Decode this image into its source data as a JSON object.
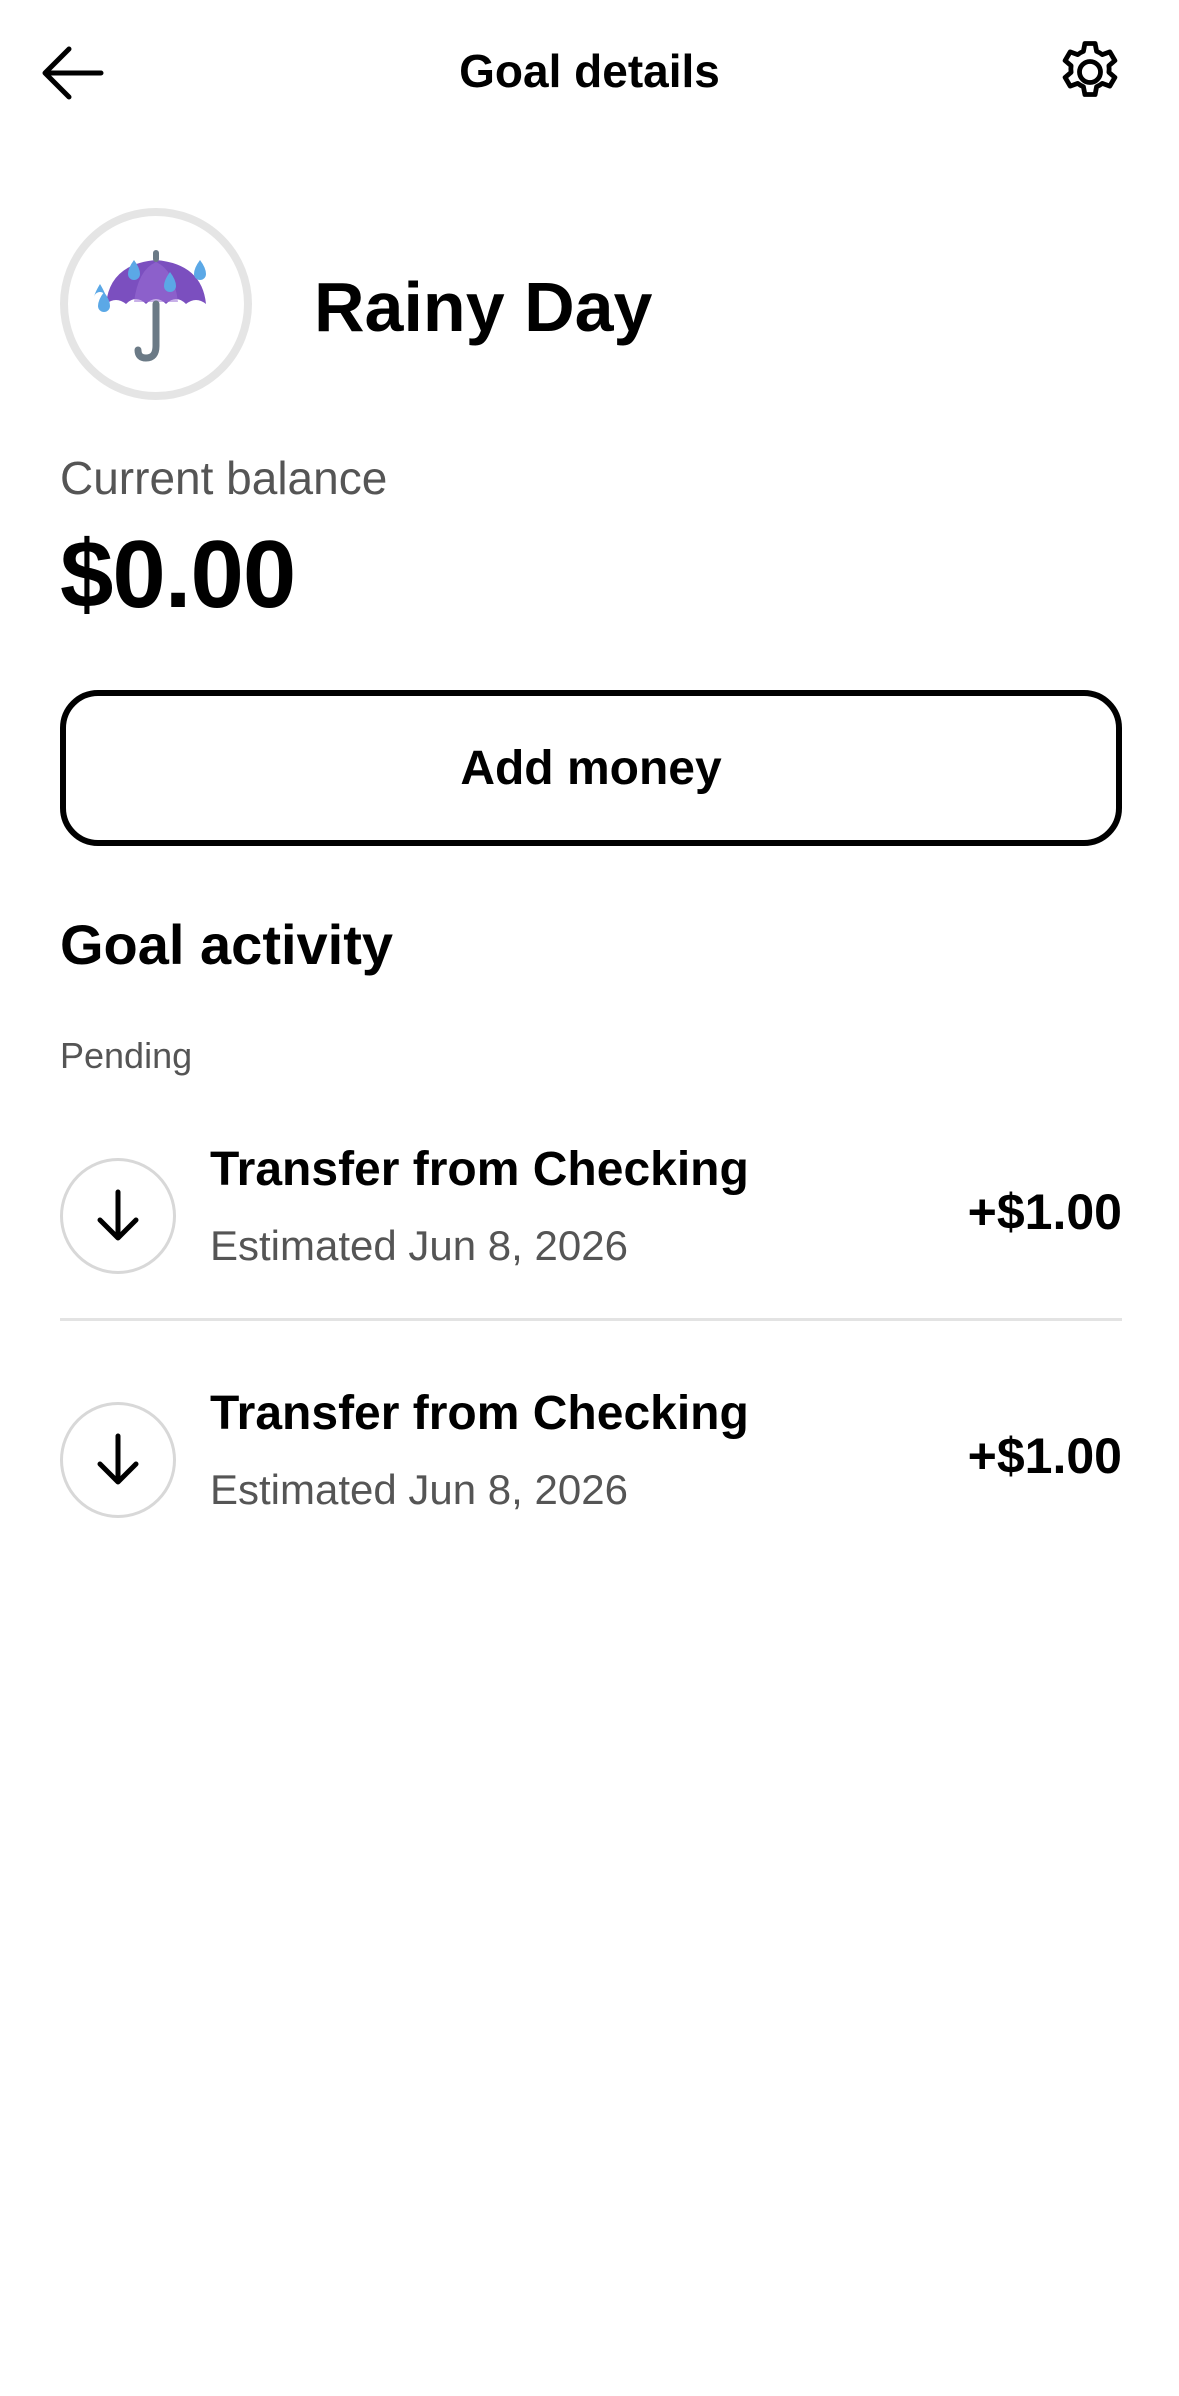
{
  "header": {
    "title": "Goal details",
    "back_icon": "arrow-left-icon",
    "settings_icon": "gear-icon"
  },
  "goal": {
    "name": "Rainy Day",
    "icon": "umbrella-with-rain-icon",
    "balance_label": "Current balance",
    "balance": "$0.00"
  },
  "actions": {
    "add_money_label": "Add money"
  },
  "activity": {
    "title": "Goal activity",
    "group_label": "Pending",
    "items": [
      {
        "title": "Transfer from Checking",
        "subtitle": "Estimated Jun 8, 2026",
        "amount": "+$1.00",
        "icon": "arrow-down-icon"
      },
      {
        "title": "Transfer from Checking",
        "subtitle": "Estimated Jun 8, 2026",
        "amount": "+$1.00",
        "icon": "arrow-down-icon"
      }
    ]
  },
  "colors": {
    "umbrella": "#7B4FBF",
    "raindrop": "#5BA8E6",
    "handle": "#6B7A86"
  }
}
